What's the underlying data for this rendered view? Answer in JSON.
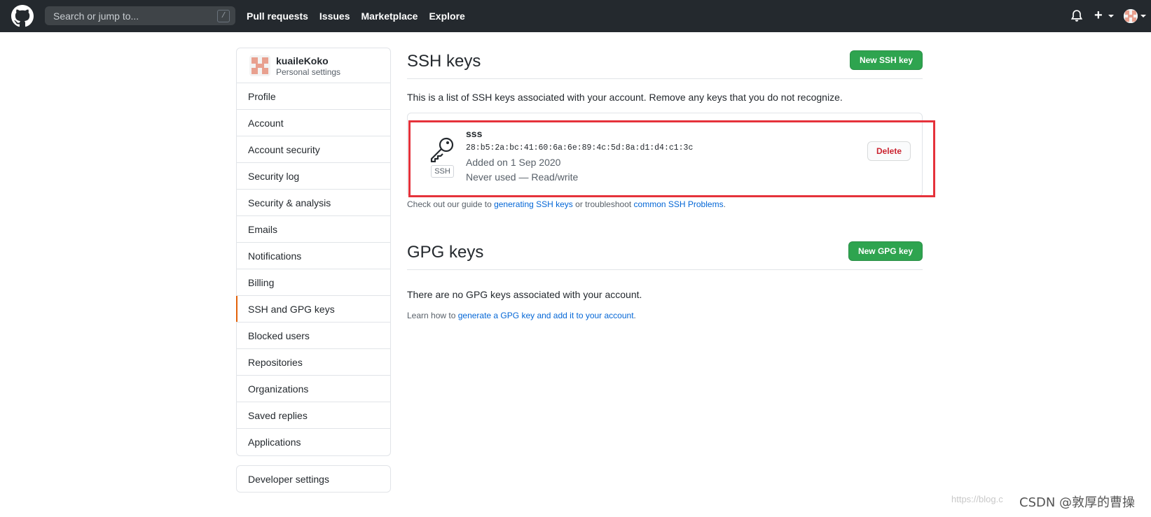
{
  "header": {
    "search_placeholder": "Search or jump to...",
    "search_shortcut": "/",
    "nav": [
      "Pull requests",
      "Issues",
      "Marketplace",
      "Explore"
    ]
  },
  "sidebar": {
    "username": "kuaileKoko",
    "subtitle": "Personal settings",
    "items": [
      {
        "label": "Profile"
      },
      {
        "label": "Account"
      },
      {
        "label": "Account security"
      },
      {
        "label": "Security log"
      },
      {
        "label": "Security & analysis"
      },
      {
        "label": "Emails"
      },
      {
        "label": "Notifications"
      },
      {
        "label": "Billing"
      },
      {
        "label": "SSH and GPG keys",
        "selected": true
      },
      {
        "label": "Blocked users"
      },
      {
        "label": "Repositories"
      },
      {
        "label": "Organizations"
      },
      {
        "label": "Saved replies"
      },
      {
        "label": "Applications"
      }
    ],
    "developer_settings": "Developer settings"
  },
  "ssh": {
    "title": "SSH keys",
    "new_button": "New SSH key",
    "description": "This is a list of SSH keys associated with your account. Remove any keys that you do not recognize.",
    "key": {
      "badge": "SSH",
      "name": "sss",
      "fingerprint": "28:b5:2a:bc:41:60:6a:6e:89:4c:5d:8a:d1:d4:c1:3c",
      "added": "Added on 1 Sep 2020",
      "usage": "Never used — Read/write",
      "delete_label": "Delete"
    },
    "guide_prefix": "Check out our guide to ",
    "guide_link1": "generating SSH keys",
    "guide_middle": " or troubleshoot ",
    "guide_link2": "common SSH Problems",
    "guide_suffix": "."
  },
  "gpg": {
    "title": "GPG keys",
    "new_button": "New GPG key",
    "empty": "There are no GPG keys associated with your account.",
    "learn_prefix": "Learn how to ",
    "learn_link": "generate a GPG key and add it to your account",
    "learn_suffix": "."
  },
  "watermark": {
    "url": "https://blog.c",
    "text": "CSDN @敦厚的曹操"
  },
  "colors": {
    "header_bg": "#24292e",
    "green": "#2ea44f",
    "link": "#0366d6",
    "danger": "#cb2431",
    "highlight": "#e5323b",
    "selected_marker": "#e36209"
  }
}
